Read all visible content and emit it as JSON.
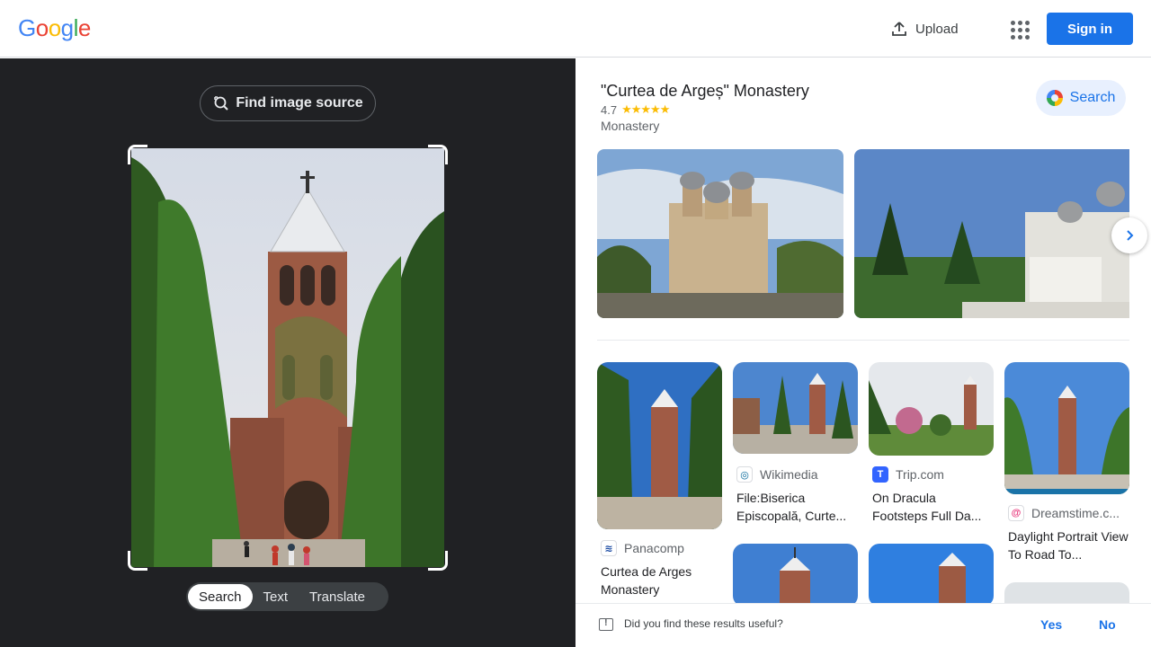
{
  "header": {
    "logo_letters": [
      "G",
      "o",
      "o",
      "g",
      "l",
      "e"
    ],
    "logo_colors": [
      "#4285f4",
      "#ea4335",
      "#fbbc05",
      "#4285f4",
      "#34a853",
      "#ea4335"
    ],
    "upload_label": "Upload",
    "apps_icon": "apps-grid-icon",
    "signin_label": "Sign in"
  },
  "left": {
    "find_source_label": "Find image source",
    "modes": [
      {
        "label": "Search",
        "active": true
      },
      {
        "label": "Text",
        "active": false
      },
      {
        "label": "Translate",
        "active": false
      }
    ]
  },
  "knowledge_panel": {
    "title": "\"Curtea de Argeș\" Monastery",
    "rating": "4.7",
    "stars": "★★★★★",
    "subtitle": "Monastery",
    "search_label": "Search"
  },
  "results": [
    {
      "source": "Panacomp",
      "title": "Curtea de Arges Monastery",
      "favicon_color": "#ffffff",
      "favicon_text": "P"
    },
    {
      "source": "Wikimedia",
      "title": "File:Biserica Episcopală, Curte...",
      "favicon_color": "#ffffff",
      "favicon_text": "W"
    },
    {
      "source": "Trip.com",
      "title": "On Dracula Footsteps Full Da...",
      "favicon_color": "#3264ff",
      "favicon_text": "T"
    },
    {
      "source": "Dreamstime.c...",
      "title": "Daylight Portrait View To Road To...",
      "favicon_color": "#ffffff",
      "favicon_text": "D"
    }
  ],
  "feedback": {
    "question": "Did you find these results useful?",
    "yes": "Yes",
    "no": "No"
  },
  "colors": {
    "accent": "#1a73e8",
    "dark_panel": "#202124",
    "star": "#fbbc04"
  }
}
